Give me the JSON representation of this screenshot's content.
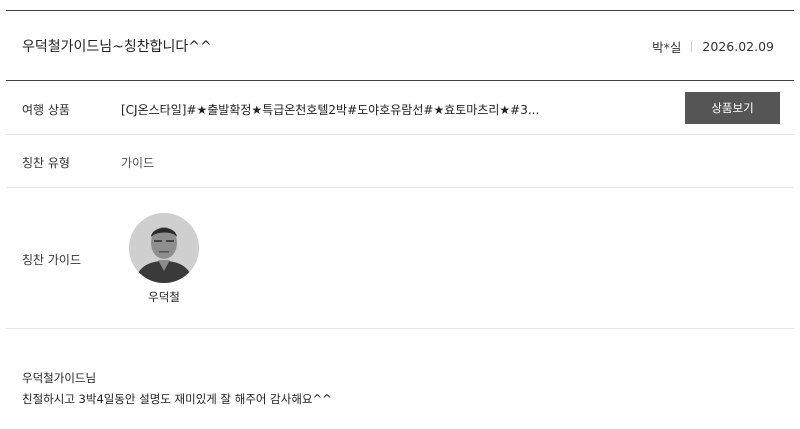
{
  "review": {
    "title": "우덕철가이드님~칭찬합니다^^",
    "author": "박*실",
    "date": "2026.02.09"
  },
  "product": {
    "label": "여행 상품",
    "value": "[CJ온스타일]#★출발확정★특급온천호텔2박#도야호유람선#★효토마츠리★#3...",
    "button_label": "상품보기"
  },
  "praise_type": {
    "label": "칭찬 유형",
    "value": "가이드"
  },
  "praise_guide": {
    "label": "칭찬 가이드",
    "name": "우덕철"
  },
  "content": {
    "line1": "우덕철가이드님",
    "line2": "친절하시고 3박4일동안 설명도 재미있게 잘 해주어 감사해요^^"
  }
}
